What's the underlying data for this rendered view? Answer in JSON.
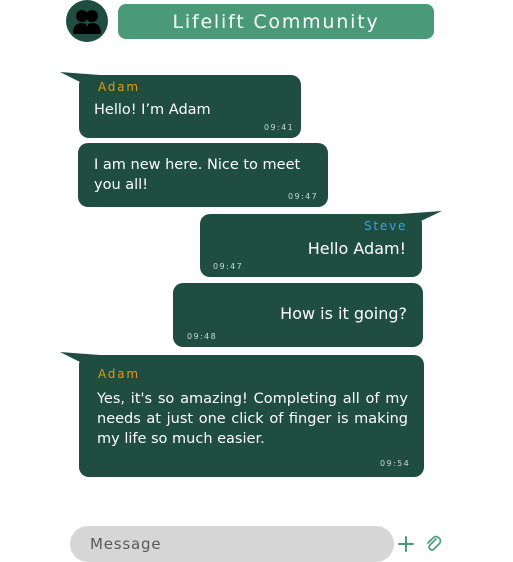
{
  "header": {
    "title": "Lifelift Community",
    "avatar_icon": "group-users-icon"
  },
  "messages": [
    {
      "sender": "Adam",
      "text": "Hello! I’m Adam",
      "time": "09:41",
      "direction": "incoming"
    },
    {
      "sender": "",
      "text": "I am new here. Nice to meet you all!",
      "time": "09:47",
      "direction": "incoming"
    },
    {
      "sender": "Steve",
      "text": "Hello Adam!",
      "time": "09:47",
      "direction": "outgoing"
    },
    {
      "sender": "",
      "text": "How is it going?",
      "time": "09:48",
      "direction": "outgoing"
    },
    {
      "sender": "Adam",
      "text": "Yes, it's so amazing! Completing all of my needs at just one click of  finger is making my life so much easier.",
      "time": "09:54",
      "direction": "incoming"
    }
  ],
  "composer": {
    "placeholder": "Message",
    "add_icon": "plus-icon",
    "attach_icon": "paperclip-icon"
  },
  "colors": {
    "bubble": "#1f4d3f",
    "header": "#4a9a78",
    "adam": "#e09a1a",
    "steve": "#3aa2e0"
  }
}
